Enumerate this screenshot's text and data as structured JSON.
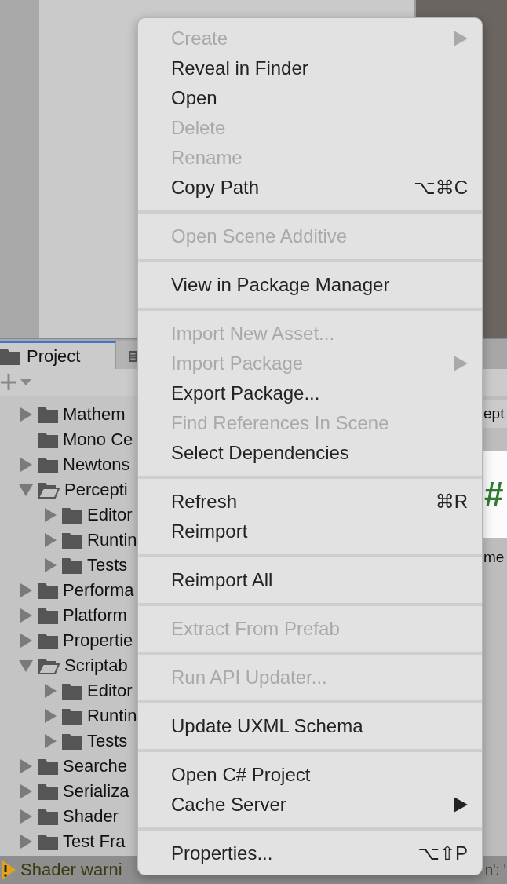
{
  "project_panel": {
    "tabs": [
      {
        "label": "Project",
        "selected": true
      },
      {
        "selected": false
      }
    ],
    "tree": [
      {
        "label": "Mathem",
        "expandable": true,
        "expanded": false
      },
      {
        "label": "Mono Ce",
        "expandable": false,
        "expanded": false
      },
      {
        "label": "Newtons",
        "expandable": true,
        "expanded": false
      },
      {
        "label": "Percepti",
        "expandable": true,
        "expanded": true,
        "children": [
          {
            "label": "Editor",
            "expandable": true,
            "expanded": false
          },
          {
            "label": "Runtin",
            "expandable": true,
            "expanded": false
          },
          {
            "label": "Tests",
            "expandable": true,
            "expanded": false
          }
        ]
      },
      {
        "label": "Performa",
        "expandable": true,
        "expanded": false
      },
      {
        "label": "Platform",
        "expandable": true,
        "expanded": false
      },
      {
        "label": "Propertie",
        "expandable": true,
        "expanded": false
      },
      {
        "label": "Scriptab",
        "expandable": true,
        "expanded": true,
        "children": [
          {
            "label": "Editor",
            "expandable": true,
            "expanded": false
          },
          {
            "label": "Runtin",
            "expandable": true,
            "expanded": false
          },
          {
            "label": "Tests",
            "expandable": true,
            "expanded": false
          }
        ]
      },
      {
        "label": "Searche",
        "expandable": true,
        "expanded": false
      },
      {
        "label": "Serializa",
        "expandable": true,
        "expanded": false
      },
      {
        "label": "Shader",
        "expandable": true,
        "expanded": false
      },
      {
        "label": "Test Fra",
        "expandable": true,
        "expanded": false
      }
    ],
    "asset_pane": {
      "breadcrumb": "ept",
      "thumbnail_glyph": "#",
      "asset_label": "me"
    }
  },
  "status_bar": {
    "message_start": "Shader warni",
    "message_end": "n': '"
  },
  "context_menu": [
    [
      {
        "label": "Create",
        "disabled": true,
        "submenu": true
      },
      {
        "label": "Reveal in Finder",
        "disabled": false,
        "submenu": false
      },
      {
        "label": "Open",
        "disabled": false,
        "submenu": false
      },
      {
        "label": "Delete",
        "disabled": true,
        "submenu": false
      },
      {
        "label": "Rename",
        "disabled": true,
        "submenu": false
      },
      {
        "label": "Copy Path",
        "disabled": false,
        "submenu": false,
        "shortcut": "⌥⌘C"
      }
    ],
    [
      {
        "label": "Open Scene Additive",
        "disabled": true,
        "submenu": false
      }
    ],
    [
      {
        "label": "View in Package Manager",
        "disabled": false,
        "submenu": false
      }
    ],
    [
      {
        "label": "Import New Asset...",
        "disabled": true,
        "submenu": false
      },
      {
        "label": "Import Package",
        "disabled": true,
        "submenu": true
      },
      {
        "label": "Export Package...",
        "disabled": false,
        "submenu": false
      },
      {
        "label": "Find References In Scene",
        "disabled": true,
        "submenu": false
      },
      {
        "label": "Select Dependencies",
        "disabled": false,
        "submenu": false
      }
    ],
    [
      {
        "label": "Refresh",
        "disabled": false,
        "submenu": false,
        "shortcut": "⌘R"
      },
      {
        "label": "Reimport",
        "disabled": false,
        "submenu": false
      }
    ],
    [
      {
        "label": "Reimport All",
        "disabled": false,
        "submenu": false
      }
    ],
    [
      {
        "label": "Extract From Prefab",
        "disabled": true,
        "submenu": false
      }
    ],
    [
      {
        "label": "Run API Updater...",
        "disabled": true,
        "submenu": false
      }
    ],
    [
      {
        "label": "Update UXML Schema",
        "disabled": false,
        "submenu": false
      }
    ],
    [
      {
        "label": "Open C# Project",
        "disabled": false,
        "submenu": false
      },
      {
        "label": "Cache Server",
        "disabled": false,
        "submenu": true
      }
    ],
    [
      {
        "label": "Properties...",
        "disabled": false,
        "submenu": false,
        "shortcut": "⌥⇧P"
      }
    ]
  ]
}
